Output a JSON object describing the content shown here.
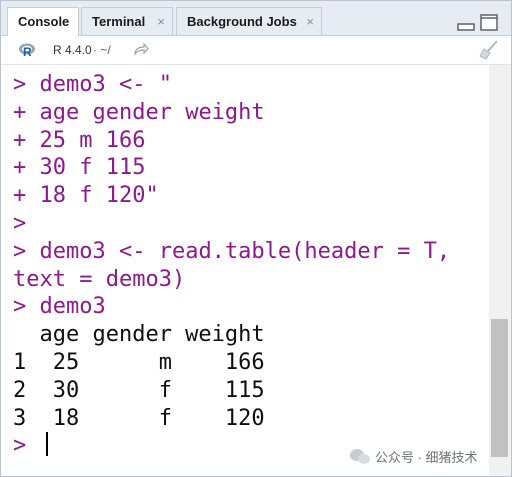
{
  "tabs": [
    {
      "label": "Console",
      "active": true
    },
    {
      "label": "Terminal",
      "close": "×"
    },
    {
      "label": "Background Jobs",
      "close": "×"
    }
  ],
  "toolbar": {
    "r_version": "R 4.4.0",
    "path": "· ~/"
  },
  "console_lines": [
    {
      "prompt": "> ",
      "text": "demo3 <- \"",
      "type": "input"
    },
    {
      "prompt": "+ ",
      "text": "age gender weight",
      "type": "input"
    },
    {
      "prompt": "+ ",
      "text": "25 m 166",
      "type": "input"
    },
    {
      "prompt": "+ ",
      "text": "30 f 115",
      "type": "input"
    },
    {
      "prompt": "+ ",
      "text": "18 f 120\"",
      "type": "input"
    },
    {
      "prompt": "> ",
      "text": "",
      "type": "input"
    },
    {
      "prompt": "> ",
      "text": "demo3 <- read.table(header = T,",
      "type": "input"
    },
    {
      "prompt": "",
      "text": "text = demo3)",
      "type": "input"
    },
    {
      "prompt": "> ",
      "text": "demo3",
      "type": "input"
    },
    {
      "prompt": "",
      "text": "  age gender weight",
      "type": "output"
    },
    {
      "prompt": "",
      "text": "1  25      m    166",
      "type": "output"
    },
    {
      "prompt": "",
      "text": "2  30      f    115",
      "type": "output"
    },
    {
      "prompt": "",
      "text": "3  18      f    120",
      "type": "output"
    },
    {
      "prompt": "> ",
      "text": "",
      "type": "cursor"
    }
  ],
  "watermark": "公众号 · 细猪技术",
  "colors": {
    "input": "#8b1a8b",
    "output": "#0f0f0f",
    "tabbar": "#e7ecf2"
  }
}
